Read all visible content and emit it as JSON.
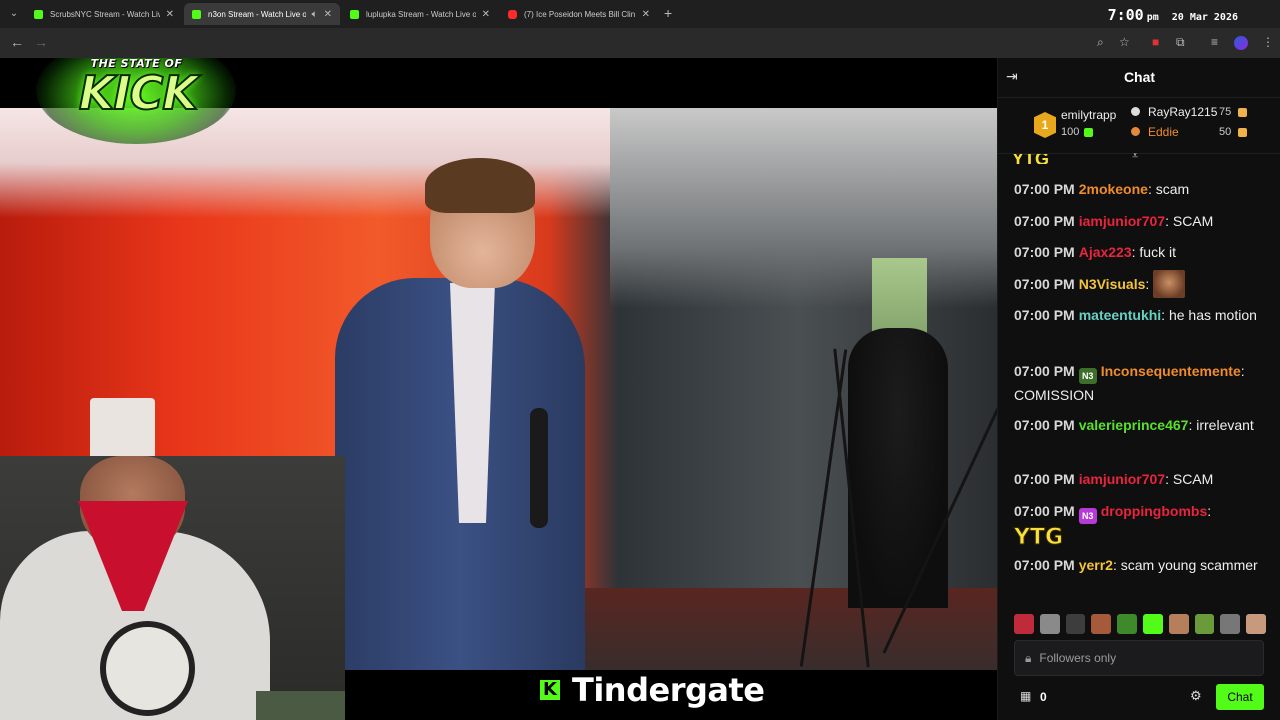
{
  "browser": {
    "tabs": [
      {
        "title": "ScrubsNYC Stream - Watch Live",
        "favicon": "kick-favicon",
        "active": false
      },
      {
        "title": "n3on Stream - Watch Live o",
        "favicon": "kick-favicon",
        "active": true
      },
      {
        "title": "luplupka Stream - Watch Live o",
        "favicon": "kick-favicon",
        "active": false
      },
      {
        "title": "(7) Ice Poseidon Meets Bill Clin",
        "favicon": "youtube-favicon",
        "active": false
      }
    ],
    "new_tab": "+",
    "clock": {
      "time": "7:00",
      "ampm": "pm",
      "date": "20 Mar 2026"
    }
  },
  "overlay": {
    "badge_top": "THE STATE OF",
    "badge_big": "KICK",
    "caption_logo": "K",
    "caption": "Tindergate"
  },
  "chat": {
    "title": "Chat",
    "leaderboard": {
      "first": {
        "rank": "1",
        "name": "emilytrapp",
        "value": "100"
      },
      "second": {
        "name": "RayRay1215",
        "value": "75"
      },
      "third": {
        "name": "Eddie",
        "value": "50"
      }
    },
    "messages": [
      {
        "time": "07:00 PM",
        "user": "2mokeone",
        "color": "#f08c2a",
        "text": "scam"
      },
      {
        "time": "07:00 PM",
        "user": "iamjunior707",
        "color": "#e8253d",
        "text": "SCAM"
      },
      {
        "time": "07:00 PM",
        "user": "Ajax223",
        "color": "#e8253d",
        "text": "fuck it"
      },
      {
        "time": "07:00 PM",
        "user": "N3Visuals",
        "color": "#f3c53a",
        "text": ""
      },
      {
        "time": "07:00 PM",
        "user": "mateentukhi",
        "color": "#67d1c3",
        "text": "he has motion"
      },
      {
        "time": "07:00 PM",
        "user": "Inconsequentemente",
        "color": "#f08c2a",
        "text": "COMISSION"
      },
      {
        "time": "07:00 PM",
        "user": "valerieprince467",
        "color": "#58e02b",
        "text": "irrelevant"
      },
      {
        "time": "07:00 PM",
        "user": "iamjunior707",
        "color": "#e8253d",
        "text": "SCAM"
      },
      {
        "time": "07:00 PM",
        "user": "droppingbombs",
        "color": "#e8253d",
        "text": "YTG"
      },
      {
        "time": "07:00 PM",
        "user": "yerr2",
        "color": "#f3c53a",
        "text": "scam young scammer"
      }
    ],
    "partial_emote": "YTG",
    "followers_only": "Followers only",
    "gift_count": "0",
    "chat_button": "Chat"
  }
}
